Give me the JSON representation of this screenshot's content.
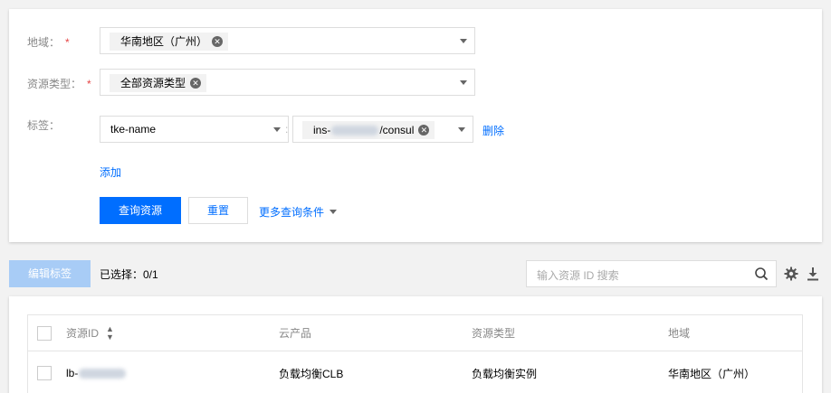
{
  "filter": {
    "region": {
      "label": "地域：",
      "required_mark": "*",
      "selected_tag": "华南地区（广州）"
    },
    "resource_type": {
      "label": "资源类型：",
      "required_mark": "*",
      "selected_tag": "全部资源类型"
    },
    "tags": {
      "label": "标签：",
      "key_value": "tke-name",
      "separator": ":",
      "value_prefix": "ins-",
      "value_suffix": "/consul",
      "delete_label": "删除"
    },
    "add_label": "添加",
    "query_button": "查询资源",
    "reset_button": "重置",
    "more_conditions": "更多查询条件"
  },
  "toolbar": {
    "edit_tags_button": "编辑标签",
    "selected_text": "已选择：0/1",
    "search_placeholder": "输入资源 ID 搜索"
  },
  "table": {
    "columns": [
      "资源ID",
      "云产品",
      "资源类型",
      "地域"
    ],
    "rows": [
      {
        "id_prefix": "lb-",
        "product": "负载均衡CLB",
        "type": "负载均衡实例",
        "region": "华南地区（广州）"
      }
    ]
  },
  "colors": {
    "primary": "#006eff",
    "disabled": "#a8ccf6",
    "required": "#e54545"
  }
}
